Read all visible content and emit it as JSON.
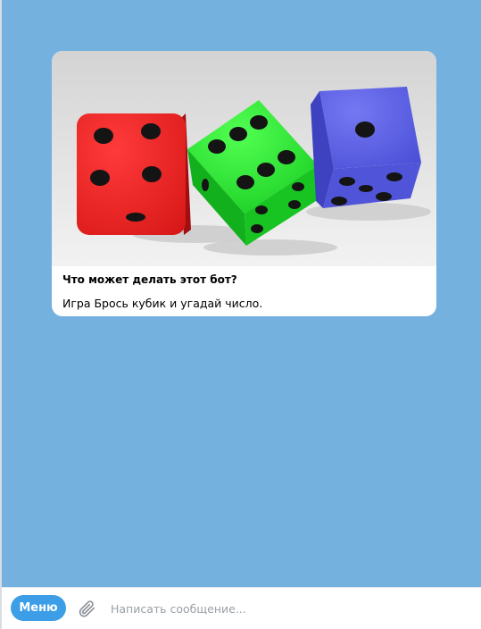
{
  "bot_intro": {
    "title": "Что может делать этот бот?",
    "description": "Игра Брось кубик и угадай число."
  },
  "composer": {
    "menu_label": "Меню",
    "placeholder": "Написать сообщение..."
  },
  "colors": {
    "chat_background": "#74b1df",
    "menu_button": "#3c9ee6",
    "die_red": "#e8222a",
    "die_green": "#1ed62c",
    "die_blue": "#5b5fe0"
  },
  "dice": [
    {
      "name": "red-die",
      "value": 5
    },
    {
      "name": "green-die",
      "value": 6
    },
    {
      "name": "blue-die",
      "value": 5
    }
  ]
}
